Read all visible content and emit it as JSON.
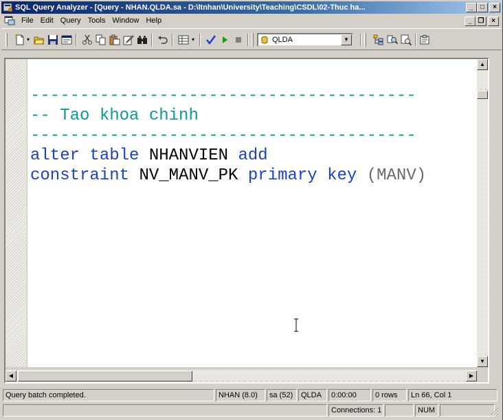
{
  "window": {
    "title": "SQL Query Analyzer - [Query - NHAN.QLDA.sa - D:\\ltnhan\\University\\Teaching\\CSDL\\02-Thuc ha..."
  },
  "title_buttons": {
    "minimize": "_",
    "maximize": "□",
    "close": "×"
  },
  "menu": {
    "items": [
      "File",
      "Edit",
      "Query",
      "Tools",
      "Window",
      "Help"
    ]
  },
  "mdi_buttons": {
    "minimize": "_",
    "restore": "❐",
    "close": "×"
  },
  "toolbar": {
    "database": "QLDA",
    "icons": [
      "new-query-icon",
      "open-icon",
      "save-icon",
      "load-script-icon",
      "cut-icon",
      "copy-icon",
      "paste-icon",
      "clear-window-icon",
      "find-icon",
      "undo-icon",
      "results-mode-icon",
      "parse-query-icon",
      "execute-query-icon",
      "cancel-query-icon",
      "database-icon",
      "object-browser-icon",
      "object-search-icon",
      "show-execution-plan-icon",
      "current-connection-icon"
    ]
  },
  "editor": {
    "lines": [
      {
        "parts": []
      },
      {
        "parts": [
          {
            "cls": "comment",
            "text": "---------------------------------------"
          }
        ]
      },
      {
        "parts": [
          {
            "cls": "comment",
            "text": "-- Tao khoa chinh"
          }
        ]
      },
      {
        "parts": [
          {
            "cls": "comment",
            "text": "---------------------------------------"
          }
        ]
      },
      {
        "parts": [
          {
            "cls": "kw",
            "text": "alter table "
          },
          {
            "cls": "ident",
            "text": "NHANVIEN "
          },
          {
            "cls": "kw",
            "text": "add"
          }
        ]
      },
      {
        "parts": [
          {
            "cls": "kw",
            "text": "constraint "
          },
          {
            "cls": "ident",
            "text": "NV_MANV_PK "
          },
          {
            "cls": "kw",
            "text": "primary key "
          },
          {
            "cls": "paren",
            "text": "(MANV)"
          }
        ]
      }
    ]
  },
  "colors": {
    "comment": "#0a9a9a",
    "keyword": "#1a3fd6",
    "identifier": "#000000",
    "title_bar": "#0a246a"
  },
  "status": {
    "message": "Query batch completed.",
    "server": "NHAN (8.0)",
    "user": "sa (52)",
    "database": "QLDA",
    "time": "0:00:00",
    "rows": "0 rows",
    "position": "Ln 66, Col 1",
    "connections": "Connections: 1",
    "num": "NUM"
  }
}
